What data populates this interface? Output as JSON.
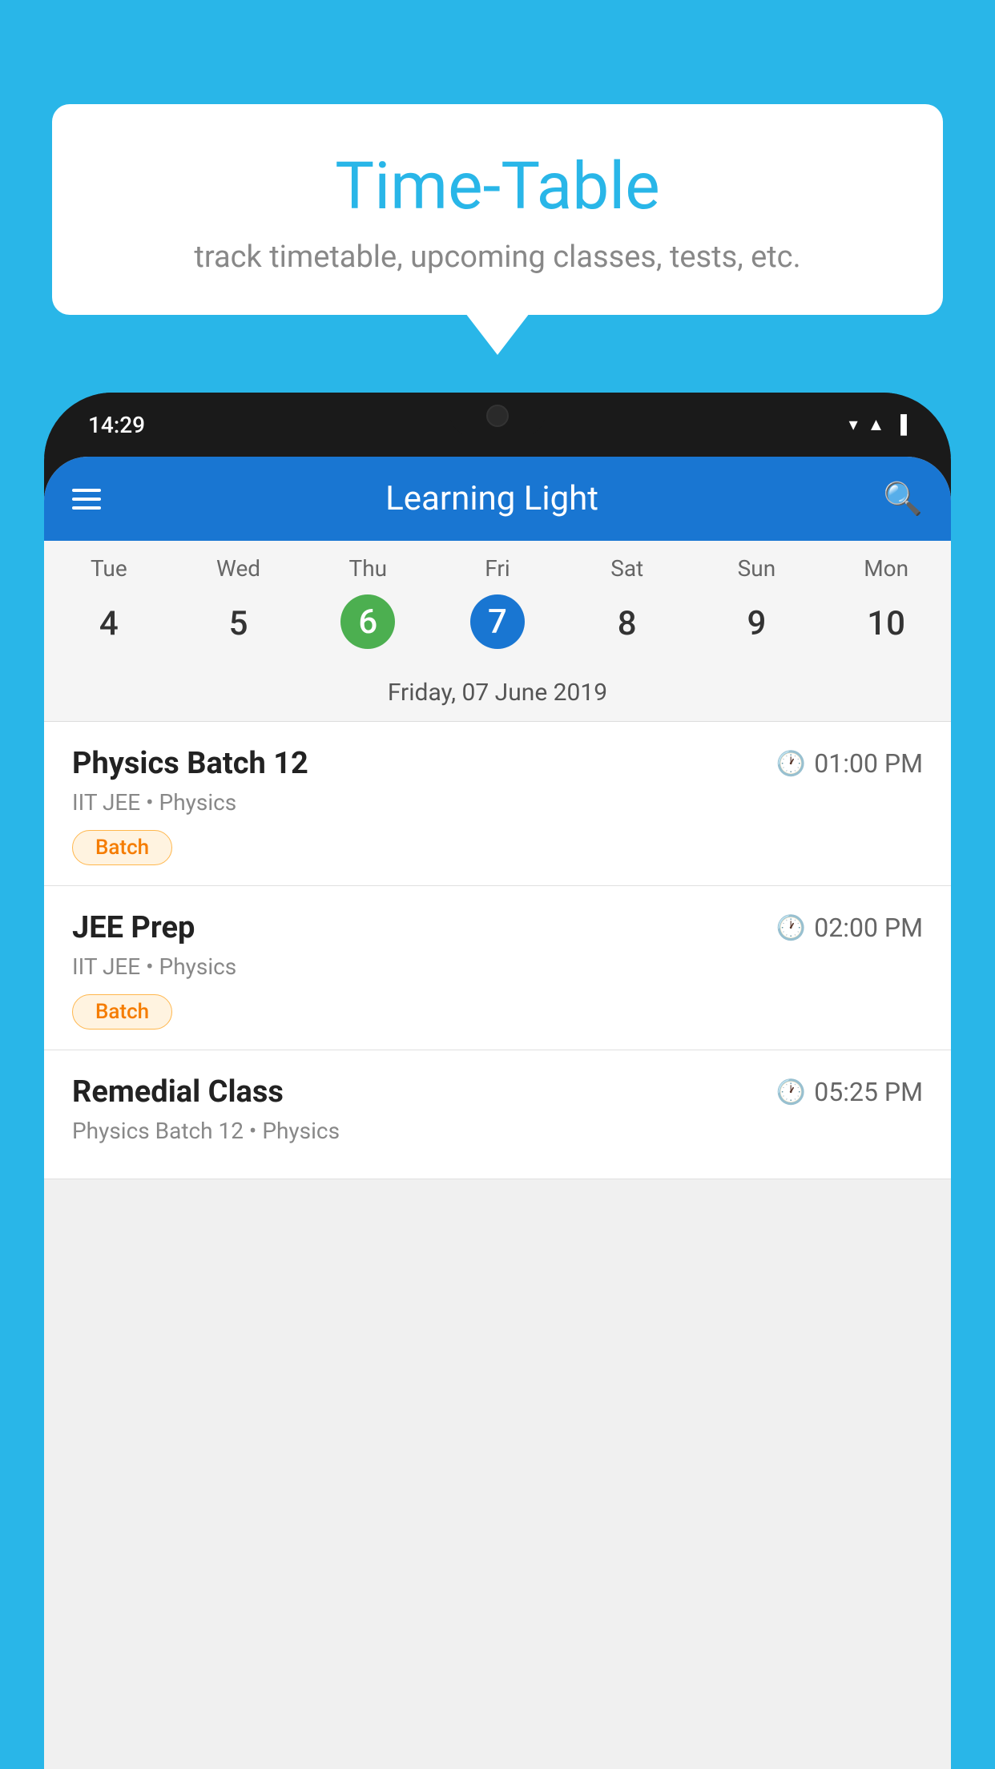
{
  "background_color": "#29B6E8",
  "speech_bubble": {
    "title": "Time-Table",
    "subtitle": "track timetable, upcoming classes, tests, etc."
  },
  "phone": {
    "status_bar": {
      "time": "14:29",
      "icons": [
        "wifi",
        "signal",
        "battery"
      ]
    },
    "app_header": {
      "title": "Learning Light",
      "menu_icon": "menu",
      "search_icon": "search"
    },
    "calendar": {
      "days": [
        {
          "label": "Tue",
          "number": "4"
        },
        {
          "label": "Wed",
          "number": "5"
        },
        {
          "label": "Thu",
          "number": "6",
          "state": "today"
        },
        {
          "label": "Fri",
          "number": "7",
          "state": "selected"
        },
        {
          "label": "Sat",
          "number": "8"
        },
        {
          "label": "Sun",
          "number": "9"
        },
        {
          "label": "Mon",
          "number": "10"
        }
      ],
      "selected_date_label": "Friday, 07 June 2019"
    },
    "schedule": {
      "items": [
        {
          "name": "Physics Batch 12",
          "time": "01:00 PM",
          "sub": "IIT JEE • Physics",
          "badge": "Batch"
        },
        {
          "name": "JEE Prep",
          "time": "02:00 PM",
          "sub": "IIT JEE • Physics",
          "badge": "Batch"
        },
        {
          "name": "Remedial Class",
          "time": "05:25 PM",
          "sub": "Physics Batch 12 • Physics",
          "badge": null
        }
      ]
    }
  }
}
